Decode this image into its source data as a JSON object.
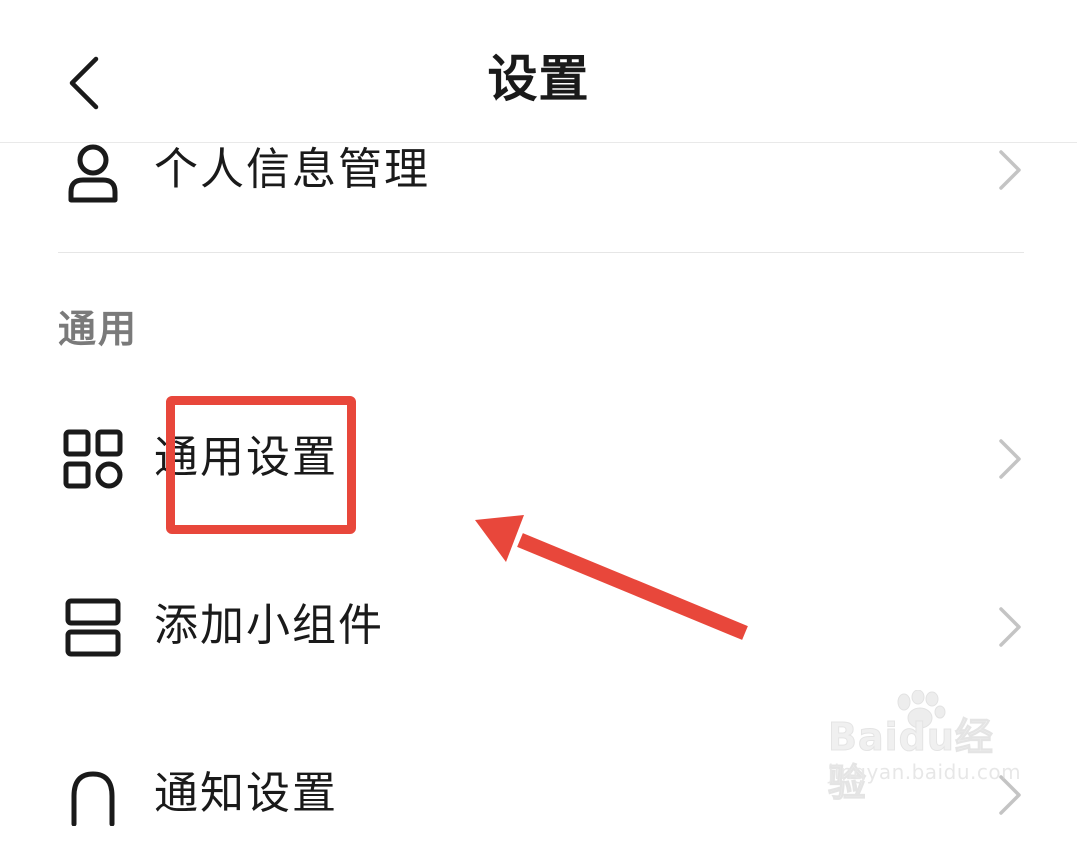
{
  "header": {
    "title": "设置",
    "back_icon": "chevron-left-icon"
  },
  "rows": [
    {
      "label": "个人信息管理",
      "icon": "person-icon"
    },
    {
      "label": "通用设置",
      "icon": "grid-apps-icon"
    },
    {
      "label": "添加小组件",
      "icon": "widget-icon"
    },
    {
      "label": "通知设置",
      "icon": "bell-icon"
    }
  ],
  "section": {
    "general_header": "通用"
  },
  "annotation": {
    "color": "#e8473b"
  },
  "watermark": {
    "brand": "Baidu经验",
    "url": "jingyan.baidu.com"
  }
}
